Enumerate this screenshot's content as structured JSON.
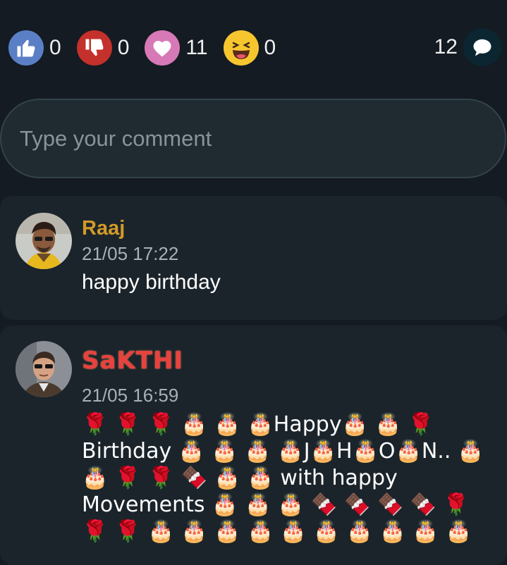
{
  "reactions": [
    {
      "name": "like",
      "count": "0",
      "color": "#5b7fc6"
    },
    {
      "name": "dislike",
      "count": "0",
      "color": "#c4302b"
    },
    {
      "name": "love",
      "count": "11",
      "color": "#d779b6"
    },
    {
      "name": "laugh",
      "count": "0",
      "color": "#f7c62f"
    }
  ],
  "comment_count": "12",
  "comment_input": {
    "placeholder": "Type your comment"
  },
  "comments": [
    {
      "author": "Raaj",
      "time": "21/05 17:22",
      "text": "happy birthday"
    },
    {
      "author": "SaKTHI",
      "time": "21/05 16:59",
      "text": "🌹 🌹 🌹 🎂 🎂 🎂Happy🎂 🎂 🌹 Birthday 🎂 🎂 🎂 🎂J🎂H🎂O🎂N.. 🎂 🎂 🌹 🌹 🍫 🎂 🎂 with happy Movements 🎂 🎂 🎂 🍫 🍫 🍫 🍫 🌹 🌹 🌹 🎂 🎂 🎂 🎂 🎂 🎂 🎂 🎂 🎂 🎂"
    }
  ]
}
